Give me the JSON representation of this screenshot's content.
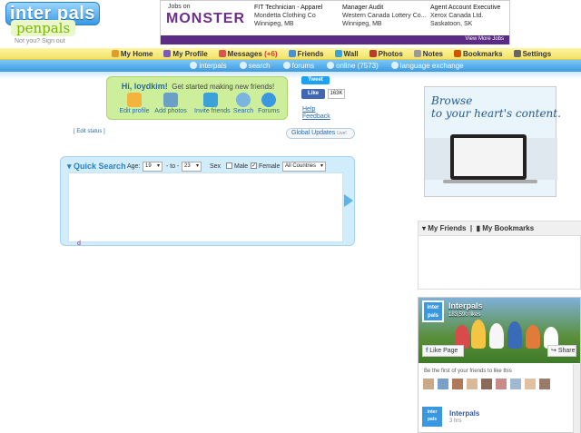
{
  "header": {
    "logo_top": "inter pals",
    "logo_bottom": "penpals",
    "not_you": "Not you? Sign out"
  },
  "jobs_ad": {
    "jobs_on": "Jobs on",
    "brand": "MONSTER",
    "jobs": [
      {
        "title": "FIT Technician - Apparel",
        "company": "Mondetta Clothing Co",
        "location": "Winnipeg, MB"
      },
      {
        "title": "Manager Audit",
        "company": "Western Canada Lottery Co...",
        "location": "Winnipeg, MB"
      },
      {
        "title": "Agent Account Executive",
        "company": "Xerox Canada Ltd.",
        "location": "Saskatoon, SK"
      }
    ],
    "more": "View More Jobs"
  },
  "nav_main": [
    {
      "label": "My Home",
      "color": "#e39b2c"
    },
    {
      "label": "My Profile",
      "color": "#7a5cc0"
    },
    {
      "label": "Messages",
      "count": "(+6)",
      "color": "#d9534f"
    },
    {
      "label": "Friends",
      "color": "#4a90d9"
    },
    {
      "label": "Wall",
      "color": "#3aa1d9"
    },
    {
      "label": "Photos",
      "color": "#c0392b"
    },
    {
      "label": "Notes",
      "color": "#999999"
    },
    {
      "label": "Bookmarks",
      "color": "#d35400"
    },
    {
      "label": "Settings",
      "color": "#666666"
    }
  ],
  "nav_sub": [
    {
      "label": "interpals"
    },
    {
      "label": "search"
    },
    {
      "label": "forums"
    },
    {
      "label": "online (7573)"
    },
    {
      "label": "language exchange"
    }
  ],
  "welcome": {
    "greeting": "Hi, loydkim!",
    "tagline": "Get started making new friends!",
    "buttons": [
      {
        "label": "Edit profile",
        "color": "#f3b33d"
      },
      {
        "label": "Add photos",
        "color": "#6aa0c8"
      },
      {
        "label": "Invite friends",
        "color": "#3aa1d9"
      },
      {
        "label": "Search",
        "color": "#7ab4e0"
      },
      {
        "label": "Forums",
        "color": "#3a98e0"
      }
    ]
  },
  "social": {
    "tweet": "Tweet",
    "like": "Like",
    "like_count": "163K",
    "help": "Help",
    "feedback": "Feedback"
  },
  "status": {
    "edit_status": "[ Edit status ]",
    "global_updates": "Global Updates",
    "live": "Live!"
  },
  "quick_search": {
    "title": "Quick Search",
    "age_label": "Age:",
    "age_from": "19",
    "to_label": "- to -",
    "age_to": "23",
    "sex_label": "Sex",
    "male_label": "Male",
    "female_label": "Female",
    "male_checked": false,
    "female_checked": true,
    "country": "All Countries",
    "result_char": "d"
  },
  "banner": {
    "line1": "Browse",
    "line2": "to your heart's content."
  },
  "side_box": {
    "my_friends": "My Friends",
    "my_bookmarks": "My Bookmarks"
  },
  "fb_page": {
    "name": "Interpals",
    "likes": "183,590 likes",
    "like_page": "Like Page",
    "share": "Share",
    "first_friends": "Be the first of your friends to like this",
    "post_name": "Interpals",
    "post_time": "3 hrs",
    "logo_text": "inter pals"
  },
  "colors": {
    "nav_yellow": "#f0e26a",
    "nav_blue": "#3c9be0",
    "welcome_green": "#cdee9a",
    "search_blue": "#d1ecfb",
    "monster_purple": "#5b2b85"
  }
}
